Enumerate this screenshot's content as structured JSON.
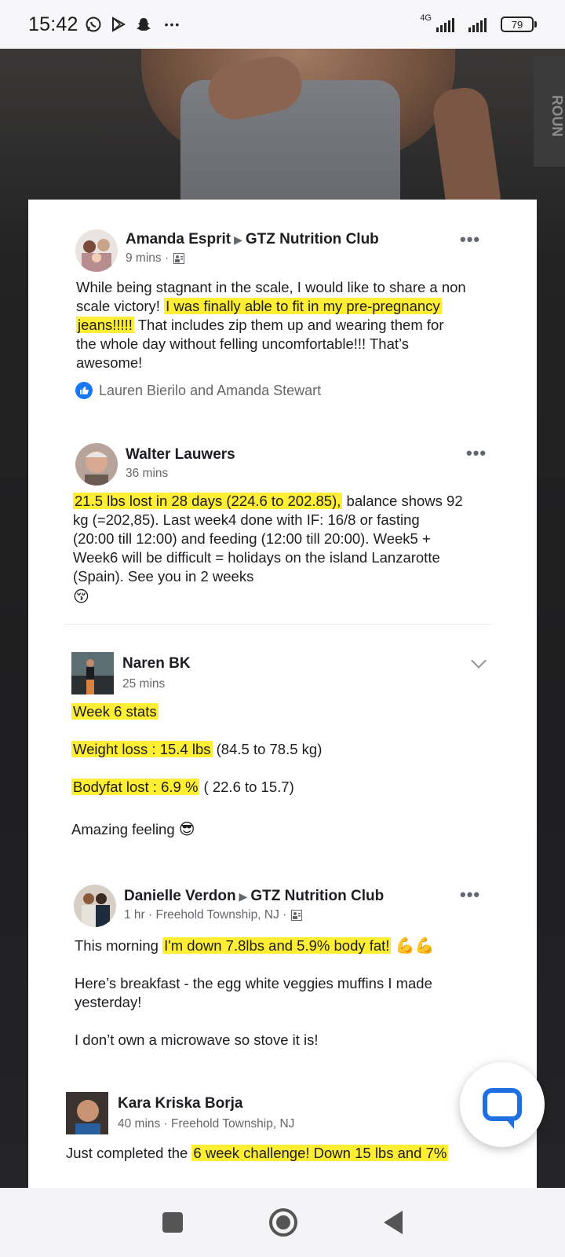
{
  "status_bar": {
    "time": "15:42",
    "network": "4G",
    "battery": "79",
    "more": "•••"
  },
  "hero": {
    "sign_text": "ROUN"
  },
  "posts": [
    {
      "author": "Amanda Esprit",
      "group": "GTZ Nutrition Club",
      "time": "9 mins ·",
      "lines": [
        [
          "While being stagnant in the scale, I would like to share a non"
        ],
        [
          "scale victory! ",
          "I was finally able to fit in my pre-pregnancy"
        ],
        [
          "jeans!!!!!",
          " That includes zip them up and wearing them for"
        ],
        [
          "the whole day without felling uncomfortable!!! That’s"
        ],
        [
          "awesome!"
        ]
      ],
      "reactions": "Lauren Bierilo and Amanda Stewart"
    },
    {
      "author": "Walter Lauwers",
      "time": "36 mins",
      "lines": [
        [
          "21.5 lbs lost in 28 days (224.6 to 202.85),",
          " balance shows 92"
        ],
        [
          "kg (=202,85). Last week4 done with IF: 16/8 or fasting"
        ],
        [
          "(20:00 till 12:00) and feeding (12:00 till 20:00). Week5 +"
        ],
        [
          "Week6 will be difficult = holidays on the island Lanzarotte"
        ],
        [
          "(Spain). See you in 2 weeks"
        ]
      ],
      "emoji": "😚"
    },
    {
      "author": "Naren BK",
      "time": "25 mins",
      "stats_title": "Week 6 stats",
      "weight_hl": "Weight loss : 15.4 lbs",
      "weight_rest": " (84.5 to 78.5 kg)",
      "bodyfat_hl": "Bodyfat lost : 6.9 %",
      "bodyfat_rest": " ( 22.6 to 15.7)",
      "closing": "Amazing feeling",
      "emoji": "😎"
    },
    {
      "author": "Danielle Verdon",
      "group": "GTZ Nutrition Club",
      "time": "1 hr · Freehold Township, NJ ·",
      "line1_plain": "This morning ",
      "line1_hl": "I'm down 7.8lbs and 5.9% body fat!",
      "emoji": "💪💪",
      "para2_l1": "Here’s breakfast - the egg white veggies muffins I made",
      "para2_l2": "yesterday!",
      "para3": "I don’t own a microwave so stove it is!"
    },
    {
      "author": "Kara Kriska Borja",
      "time": "40 mins · Freehold Township, NJ",
      "line1_plain": "Just completed the ",
      "line1_hl": "6 week challenge! Down 15 lbs and 7%"
    }
  ],
  "colors": {
    "highlight": "#ffee33",
    "link_blue": "#1877f2",
    "chat_blue": "#1f6fe0"
  },
  "icons": {
    "more": "more-options-icon",
    "like": "like-icon",
    "chat": "chat-icon",
    "group_privacy": "group-icon"
  }
}
